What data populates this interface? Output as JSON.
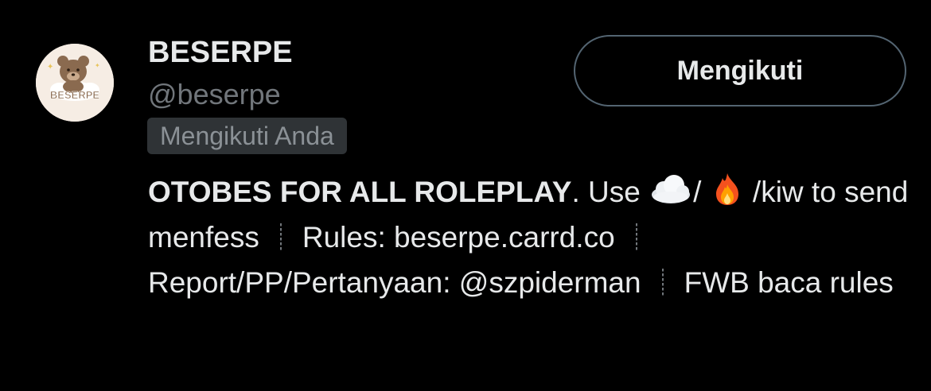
{
  "profile": {
    "name": "BESERPE",
    "handle": "@beserpe",
    "follows_you_label": "Mengikuti Anda",
    "avatar_text": "BESERPE",
    "follow_button_label": "Mengikuti"
  },
  "bio": {
    "strong_text": "OTOBES FOR ALL ROLEPLAY",
    "dot": ".",
    "use_text": " Use ",
    "slash1": "/ ",
    "slash2": " /kiw to send menfess",
    "rules_text": "Rules: beserpe.carrd.co",
    "report_text": "Report/PP/Pertanyaan: @szpiderman",
    "fwb_text": "FWB baca rules",
    "icons": [
      "cloud-emoji-icon",
      "fire-emoji-icon"
    ]
  },
  "colors": {
    "background": "#000000",
    "primary_text": "#e7e9ea",
    "secondary_text": "#71767b",
    "badge_bg": "#2f3336",
    "button_border": "#536471"
  }
}
